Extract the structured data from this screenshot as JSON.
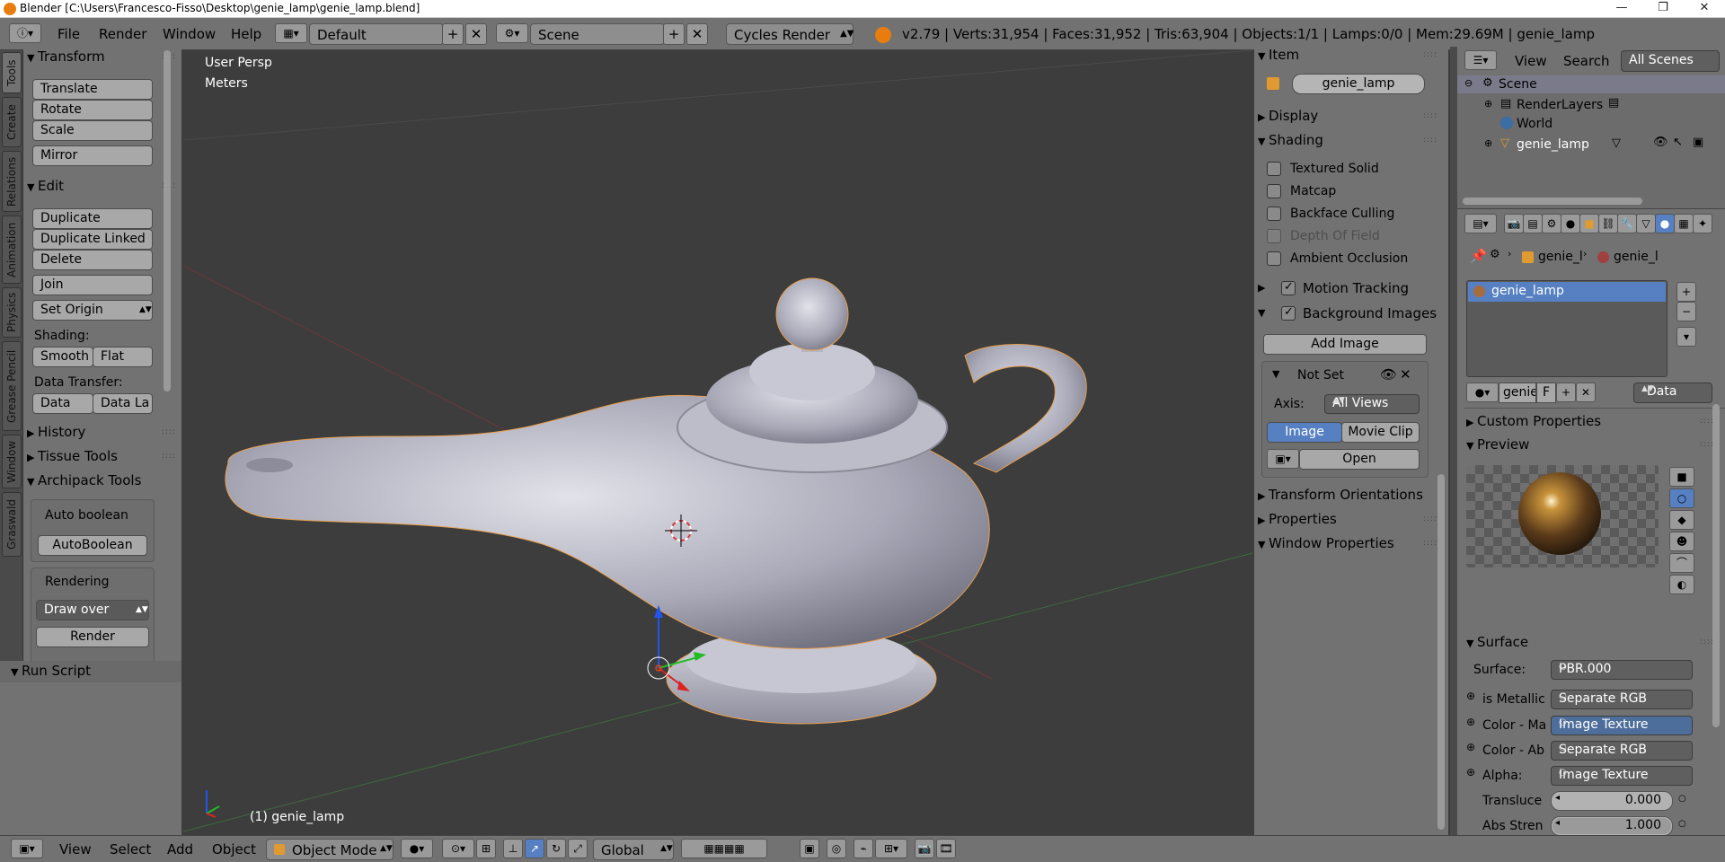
{
  "window": {
    "title": "Blender [C:\\Users\\Francesco-Fisso\\Desktop\\genie_lamp\\genie_lamp.blend]",
    "minimize": "—",
    "maximize": "❐",
    "close": "✕"
  },
  "topbar": {
    "menus": [
      "File",
      "Render",
      "Window",
      "Help"
    ],
    "layout": "Default",
    "scene": "Scene",
    "engine": "Cycles Render",
    "stats": "v2.79 | Verts:31,954 | Faces:31,952 | Tris:63,904 | Objects:1/1 | Lamps:0/0 | Mem:29.69M | genie_lamp"
  },
  "tooltabs": [
    "Tools",
    "Create",
    "Relations",
    "Animation",
    "Physics",
    "Grease Pencil",
    "Window",
    "Graswald"
  ],
  "toolpanel": {
    "transform": {
      "title": "Transform",
      "buttons": [
        "Translate",
        "Rotate",
        "Scale",
        "Mirror"
      ]
    },
    "edit": {
      "title": "Edit",
      "buttons": [
        "Duplicate",
        "Duplicate Linked",
        "Delete",
        "Join"
      ],
      "set_origin": "Set Origin",
      "shading_label": "Shading:",
      "smooth": "Smooth",
      "flat": "Flat",
      "data_transfer_label": "Data Transfer:",
      "data": "Data",
      "data_la": "Data La"
    },
    "history": "History",
    "tissue": "Tissue Tools",
    "archipack": {
      "title": "Archipack Tools",
      "auto_boolean_label": "Auto boolean",
      "auto_boolean_btn": "AutoBoolean",
      "rendering_label": "Rendering",
      "draw_over": "Draw over",
      "render": "Render"
    },
    "run_script": "Run Script"
  },
  "viewport": {
    "persp": "User Persp",
    "units": "Meters",
    "object_label": "(1) genie_lamp"
  },
  "npanel": {
    "item": {
      "title": "Item",
      "name": "genie_lamp"
    },
    "display": "Display",
    "shading": {
      "title": "Shading",
      "options": [
        {
          "label": "Textured Solid",
          "checked": false,
          "disabled": false
        },
        {
          "label": "Matcap",
          "checked": false,
          "disabled": false
        },
        {
          "label": "Backface Culling",
          "checked": false,
          "disabled": false
        },
        {
          "label": "Depth Of Field",
          "checked": false,
          "disabled": true
        },
        {
          "label": "Ambient Occlusion",
          "checked": false,
          "disabled": false
        }
      ]
    },
    "motion_tracking": "Motion Tracking",
    "background_images": {
      "title": "Background Images",
      "add_image": "Add Image",
      "not_set": "Not Set",
      "axis_label": "Axis:",
      "axis_value": "All Views",
      "image": "Image",
      "movie_clip": "Movie Clip",
      "open": "Open"
    },
    "transform_orientations": "Transform Orientations",
    "properties": "Properties",
    "window_properties": "Window Properties"
  },
  "outliner": {
    "view": "View",
    "search": "Search",
    "filter": "All Scenes",
    "items": [
      "Scene",
      "RenderLayers",
      "World",
      "genie_lamp"
    ]
  },
  "props": {
    "breadcrumb": [
      "genie_l",
      "genie_l"
    ],
    "material_slot": "genie_lamp",
    "mat_name": "genie",
    "f": "F",
    "data": "Data",
    "custom_properties": "Custom Properties",
    "preview": "Preview",
    "surface": {
      "title": "Surface",
      "surface_label": "Surface:",
      "surface_value": "PBR.000",
      "rows": [
        {
          "label": "is Metallic",
          "value": "Separate RGB",
          "active": false
        },
        {
          "label": "Color - Ma",
          "value": "Image Texture",
          "active": true
        },
        {
          "label": "Color - Ab",
          "value": "Separate RGB",
          "active": false
        },
        {
          "label": "Alpha:",
          "value": "Image Texture",
          "active": false
        }
      ],
      "transluce_label": "Transluce",
      "transluce_value": "0.000",
      "transluce_fill": 0.0,
      "absstren_label": "Abs Stren",
      "absstren_value": "1.000",
      "absstren_fill": 1.0
    }
  },
  "bottombar": {
    "menus": [
      "View",
      "Select",
      "Add",
      "Object"
    ],
    "mode": "Object Mode",
    "orientation": "Global"
  }
}
